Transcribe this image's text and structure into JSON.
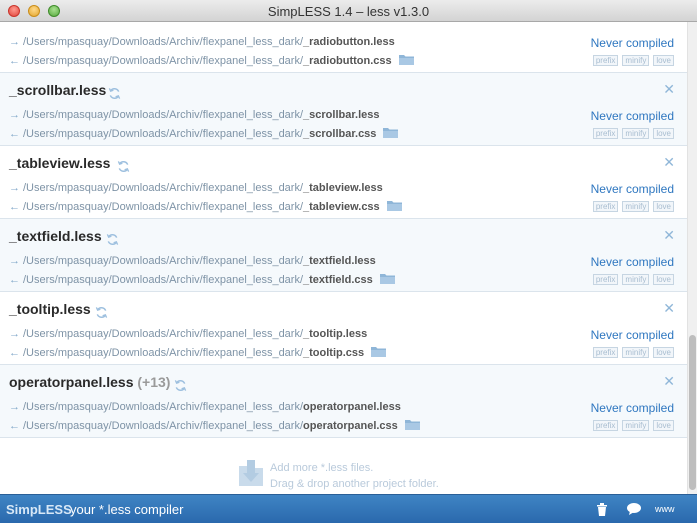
{
  "window": {
    "title": "SimpLESS 1.4 – less v1.3.0"
  },
  "files": [
    {
      "name": "",
      "extra": "",
      "source_prefix": "/Users/mpasquay/Downloads/Archiv/flexpanel_less_dark/",
      "source_file": "_radiobutton.less",
      "output_prefix": "/Users/mpasquay/Downloads/Archiv/flexpanel_less_dark/",
      "output_file": "_radiobutton.css",
      "status": "Never compiled",
      "tags": [
        "prefix",
        "minify",
        "love"
      ]
    },
    {
      "name": "_scrollbar.less",
      "extra": "",
      "source_prefix": "/Users/mpasquay/Downloads/Archiv/flexpanel_less_dark/",
      "source_file": "_scrollbar.less",
      "output_prefix": "/Users/mpasquay/Downloads/Archiv/flexpanel_less_dark/",
      "output_file": "_scrollbar.css",
      "status": "Never compiled",
      "tags": [
        "prefix",
        "minify",
        "love"
      ]
    },
    {
      "name": "_tableview.less",
      "extra": "",
      "source_prefix": "/Users/mpasquay/Downloads/Archiv/flexpanel_less_dark/",
      "source_file": "_tableview.less",
      "output_prefix": "/Users/mpasquay/Downloads/Archiv/flexpanel_less_dark/",
      "output_file": "_tableview.css",
      "status": "Never compiled",
      "tags": [
        "prefix",
        "minify",
        "love"
      ]
    },
    {
      "name": "_textfield.less",
      "extra": "",
      "source_prefix": "/Users/mpasquay/Downloads/Archiv/flexpanel_less_dark/",
      "source_file": "_textfield.less",
      "output_prefix": "/Users/mpasquay/Downloads/Archiv/flexpanel_less_dark/",
      "output_file": "_textfield.css",
      "status": "Never compiled",
      "tags": [
        "prefix",
        "minify",
        "love"
      ]
    },
    {
      "name": "_tooltip.less",
      "extra": "",
      "source_prefix": "/Users/mpasquay/Downloads/Archiv/flexpanel_less_dark/",
      "source_file": "_tooltip.less",
      "output_prefix": "/Users/mpasquay/Downloads/Archiv/flexpanel_less_dark/",
      "output_file": "_tooltip.css",
      "status": "Never compiled",
      "tags": [
        "prefix",
        "minify",
        "love"
      ]
    },
    {
      "name": "operatorpanel.less",
      "extra": "(+13)",
      "source_prefix": "/Users/mpasquay/Downloads/Archiv/flexpanel_less_dark/",
      "source_file": "operatorpanel.less",
      "output_prefix": "/Users/mpasquay/Downloads/Archiv/flexpanel_less_dark/",
      "output_file": "operatorpanel.css",
      "status": "Never compiled",
      "tags": [
        "prefix",
        "minify",
        "love"
      ]
    }
  ],
  "drop_zone": {
    "line1": "Add more *.less files.",
    "line2": "Drag & drop another project folder."
  },
  "footer": {
    "brand": "SimpLESS",
    "tagline": "your *.less compiler",
    "www_label": "www"
  },
  "icons": {
    "refresh": "refresh-icon",
    "remove": "close-icon",
    "folder": "folder-icon",
    "trash": "trash-icon",
    "chat": "speech-bubble-icon"
  },
  "colors": {
    "accent": "#2f77c0",
    "footer_bg": "#3478bb",
    "row_alt": "#f5f9fc"
  }
}
